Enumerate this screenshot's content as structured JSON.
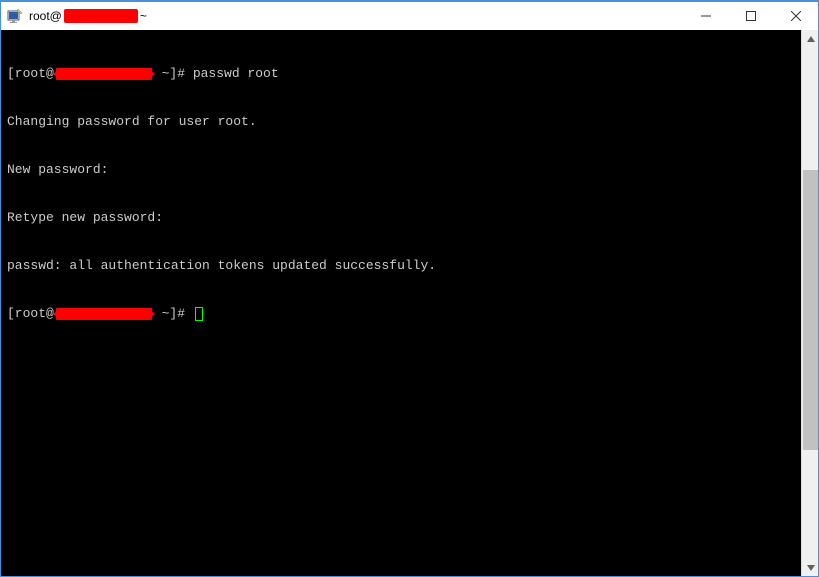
{
  "titlebar": {
    "prefix": "root@",
    "suffix": " ~"
  },
  "terminal": {
    "line1_prefix": "[root@",
    "line1_mid": " ~]# ",
    "line1_cmd": "passwd root",
    "line2": "Changing password for user root.",
    "line3": "New password:",
    "line4": "Retype new password:",
    "line5": "passwd: all authentication tokens updated successfully.",
    "line6_prefix": "[root@",
    "line6_mid": " ~]# "
  }
}
